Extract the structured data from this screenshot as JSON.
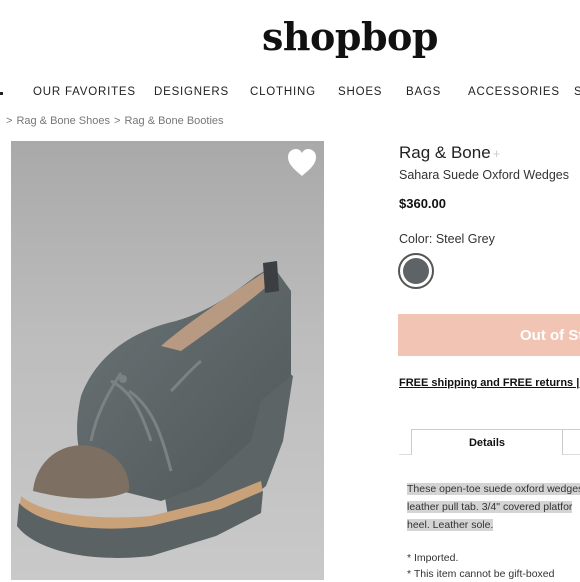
{
  "header": {
    "logo": "shopbop"
  },
  "nav": {
    "items": [
      "OUR FAVORITES",
      "DESIGNERS",
      "CLOTHING",
      "SHOES",
      "BAGS",
      "ACCESSORIES",
      "S"
    ]
  },
  "breadcrumb": {
    "sep": ">",
    "items": [
      "Rag & Bone Shoes",
      "Rag & Bone Booties"
    ]
  },
  "product": {
    "brand": "Rag & Bone",
    "brand_plus": "+",
    "name": "Sahara Suede Oxford Wedges",
    "price": "$360.00",
    "color_label": "Color: Steel Grey",
    "swatch_color": "#5e6466",
    "button_label": "Out of St",
    "shipping_text": "FREE shipping and FREE returns | ama",
    "tabs": {
      "details": "Details"
    },
    "description_lines": [
      "These open-toe suede oxford wedges",
      "leather pull tab. 3/4\" covered platfor",
      "heel. Leather sole."
    ],
    "notes": [
      "* Imported.",
      "* This item cannot be gift-boxed"
    ]
  },
  "colors": {
    "button_bg": "#f2c4b4",
    "accent_text": "#111111"
  }
}
